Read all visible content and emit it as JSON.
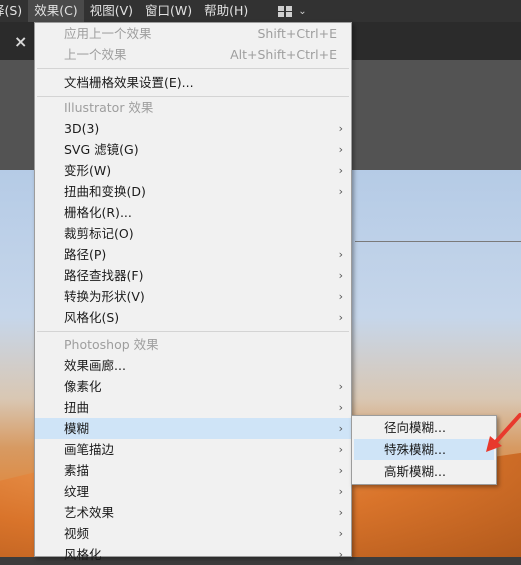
{
  "menubar": {
    "items": [
      "择(S)",
      "效果(C)",
      "视图(V)",
      "窗口(W)",
      "帮助(H)"
    ]
  },
  "menu": {
    "items": [
      {
        "label": "应用上一个效果",
        "shortcut": "Shift+Ctrl+E",
        "disabled": true
      },
      {
        "label": "上一个效果",
        "shortcut": "Alt+Shift+Ctrl+E",
        "disabled": true
      },
      {
        "label": "文档栅格效果设置(E)..."
      },
      {
        "label": "Illustrator 效果",
        "header": true
      },
      {
        "label": "3D(3)",
        "submenu": true
      },
      {
        "label": "SVG 滤镜(G)",
        "submenu": true
      },
      {
        "label": "变形(W)",
        "submenu": true
      },
      {
        "label": "扭曲和变换(D)",
        "submenu": true
      },
      {
        "label": "栅格化(R)..."
      },
      {
        "label": "裁剪标记(O)"
      },
      {
        "label": "路径(P)",
        "submenu": true
      },
      {
        "label": "路径查找器(F)",
        "submenu": true
      },
      {
        "label": "转换为形状(V)",
        "submenu": true
      },
      {
        "label": "风格化(S)",
        "submenu": true
      },
      {
        "label": "Photoshop 效果",
        "header": true
      },
      {
        "label": "效果画廊..."
      },
      {
        "label": "像素化",
        "submenu": true
      },
      {
        "label": "扭曲",
        "submenu": true
      },
      {
        "label": "模糊",
        "submenu": true,
        "highlight": true
      },
      {
        "label": "画笔描边",
        "submenu": true
      },
      {
        "label": "素描",
        "submenu": true
      },
      {
        "label": "纹理",
        "submenu": true
      },
      {
        "label": "艺术效果",
        "submenu": true
      },
      {
        "label": "视频",
        "submenu": true
      },
      {
        "label": "风格化",
        "submenu": true
      }
    ]
  },
  "submenu": {
    "items": [
      {
        "label": "径向模糊..."
      },
      {
        "label": "特殊模糊...",
        "highlight": true
      },
      {
        "label": "高斯模糊..."
      }
    ]
  },
  "icons": {
    "tab_close": "×",
    "submenu_arrow": "›",
    "workspace_chevron": "⌄"
  },
  "colors": {
    "menu_bg": "#f1f1f1",
    "highlight": "#cfe4f7",
    "annotation": "#e8392d"
  }
}
